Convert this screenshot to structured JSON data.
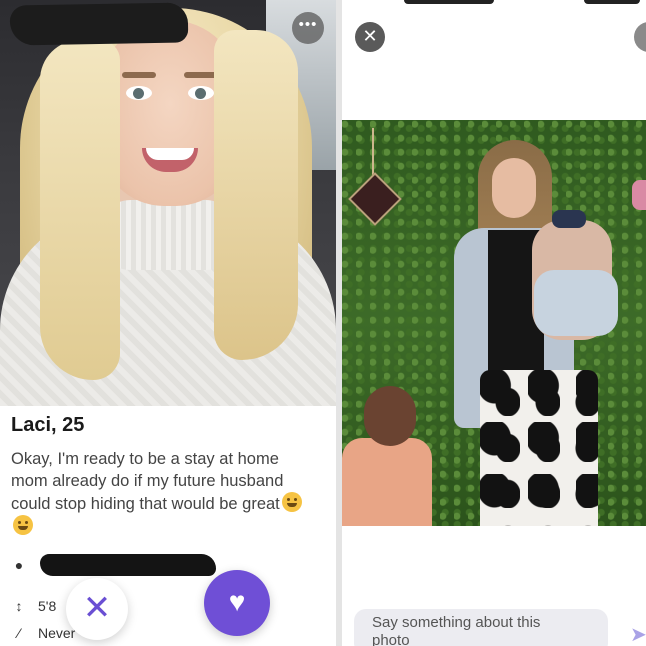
{
  "profile": {
    "name": "Laci, 25",
    "bio": "Okay, I'm ready to be a stay at home mom already do if my future husband could stop hiding that would be great",
    "emoji": [
      "grimacing-face-icon",
      "grinning-face-icon"
    ],
    "height": "5'8",
    "drinking": "Never"
  },
  "icons": {
    "more": "•••",
    "pass": "✕",
    "like": "♥",
    "close": "✕",
    "location": "●",
    "height": "↕",
    "drink": "⁄",
    "send": "➤"
  },
  "comment": {
    "placeholder": "Say something about this photo"
  },
  "colors": {
    "accent": "#6f4fd6",
    "redaction": "#1c1c1c"
  }
}
